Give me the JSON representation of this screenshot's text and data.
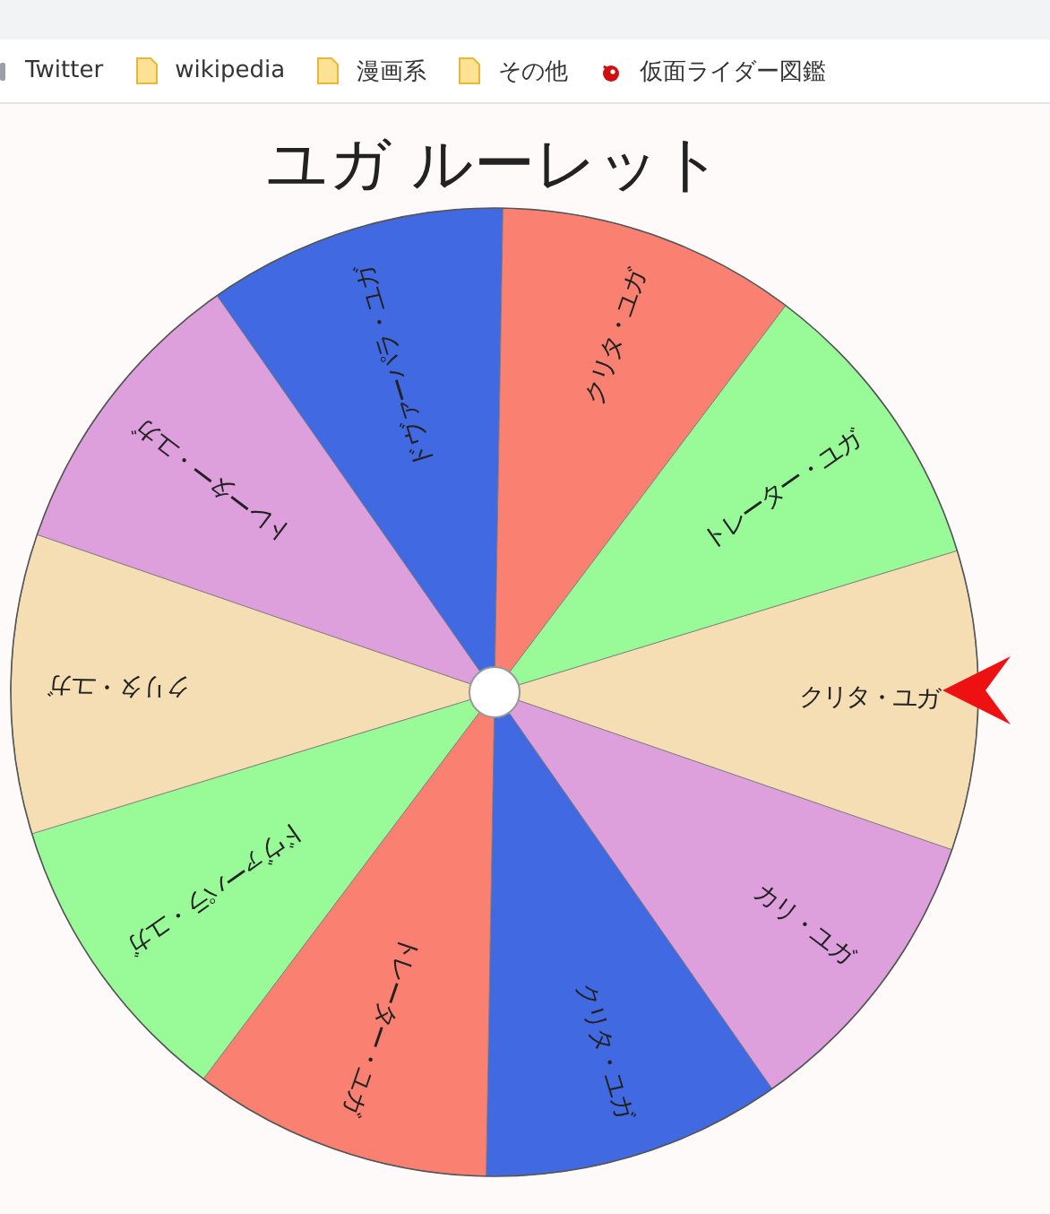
{
  "bookmarks": [
    {
      "kind": "site",
      "label": "Twitter"
    },
    {
      "kind": "folder",
      "label": "wikipedia"
    },
    {
      "kind": "folder",
      "label": "漫画系"
    },
    {
      "kind": "folder",
      "label": "その他"
    },
    {
      "kind": "app",
      "label": "仮面ライダー図鑑"
    }
  ],
  "title": "ユガ ルーレット",
  "segments": [
    {
      "label": "クリタ・ユガ",
      "color": "#f5deb3"
    },
    {
      "label": "カリ・ユガ",
      "color": "#dda0dd"
    },
    {
      "label": "クリタ・ユガ",
      "color": "#4169e1"
    },
    {
      "label": "トレーター・ユガ",
      "color": "#fa8072"
    },
    {
      "label": "ドヴァーパラ・ユガ",
      "color": "#98fb98"
    },
    {
      "label": "クリタ・ユガ",
      "color": "#f5deb3"
    },
    {
      "label": "トレーター・ユガ",
      "color": "#dda0dd"
    },
    {
      "label": "ドヴァーパラ・ユガ",
      "color": "#4169e1"
    },
    {
      "label": "クリタ・ユガ",
      "color": "#fa8072"
    },
    {
      "label": "トレーター・ユガ",
      "color": "#98fb98"
    }
  ]
}
